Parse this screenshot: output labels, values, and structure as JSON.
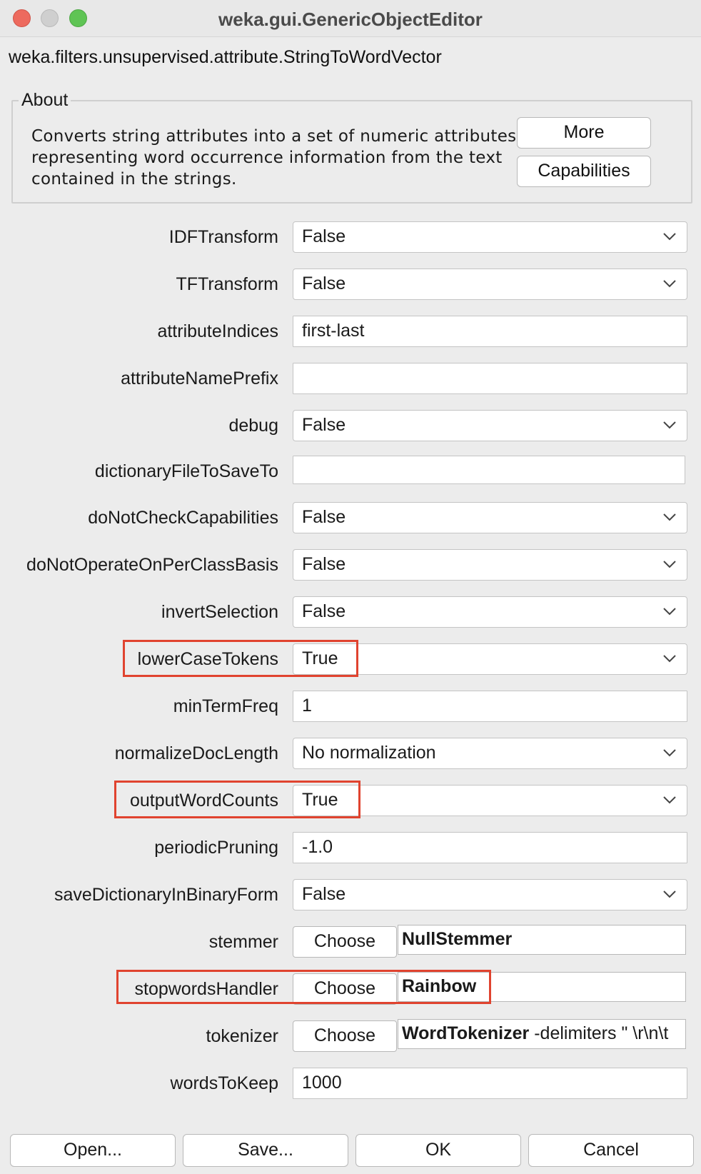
{
  "window": {
    "title": "weka.gui.GenericObjectEditor"
  },
  "classname": "weka.filters.unsupervised.attribute.StringToWordVector",
  "about": {
    "legend": "About",
    "lines": [
      "Converts string attributes into a set of numeric attributes",
      "representing word occurrence information from the text",
      "contained in the strings."
    ],
    "more_label": "More",
    "capabilities_label": "Capabilities"
  },
  "properties": {
    "IDFTransform": {
      "label": "IDFTransform",
      "value": "False"
    },
    "TFTransform": {
      "label": "TFTransform",
      "value": "False"
    },
    "attributeIndices": {
      "label": "attributeIndices",
      "value": "first-last"
    },
    "attributeNamePrefix": {
      "label": "attributeNamePrefix",
      "value": ""
    },
    "debug": {
      "label": "debug",
      "value": "False"
    },
    "dictionaryFileToSaveTo": {
      "label": "dictionaryFileToSaveTo",
      "value": ""
    },
    "doNotCheckCapabilities": {
      "label": "doNotCheckCapabilities",
      "value": "False"
    },
    "doNotOperateOnPerClassBasis": {
      "label": "doNotOperateOnPerClassBasis",
      "value": "False"
    },
    "invertSelection": {
      "label": "invertSelection",
      "value": "False"
    },
    "lowerCaseTokens": {
      "label": "lowerCaseTokens",
      "value": "True"
    },
    "minTermFreq": {
      "label": "minTermFreq",
      "value": "1"
    },
    "normalizeDocLength": {
      "label": "normalizeDocLength",
      "value": "No normalization"
    },
    "outputWordCounts": {
      "label": "outputWordCounts",
      "value": "True"
    },
    "periodicPruning": {
      "label": "periodicPruning",
      "value": "-1.0"
    },
    "saveDictionaryInBinaryForm": {
      "label": "saveDictionaryInBinaryForm",
      "value": "False"
    },
    "stemmer": {
      "label": "stemmer",
      "choose_label": "Choose",
      "value_bold": "NullStemmer",
      "value_rest": ""
    },
    "stopwordsHandler": {
      "label": "stopwordsHandler",
      "choose_label": "Choose",
      "value_bold": "Rainbow",
      "value_rest": ""
    },
    "tokenizer": {
      "label": "tokenizer",
      "choose_label": "Choose",
      "value_bold": "WordTokenizer",
      "value_rest": " -delimiters \" \\r\\n\\t"
    },
    "wordsToKeep": {
      "label": "wordsToKeep",
      "value": "1000"
    }
  },
  "buttons": {
    "open": "Open...",
    "save": "Save...",
    "ok": "OK",
    "cancel": "Cancel"
  },
  "colors": {
    "highlight": "#e0432f",
    "close": "#ed6a5e",
    "maximize": "#5fc454"
  },
  "icons": {
    "dropdown": "chevron-down-icon"
  }
}
